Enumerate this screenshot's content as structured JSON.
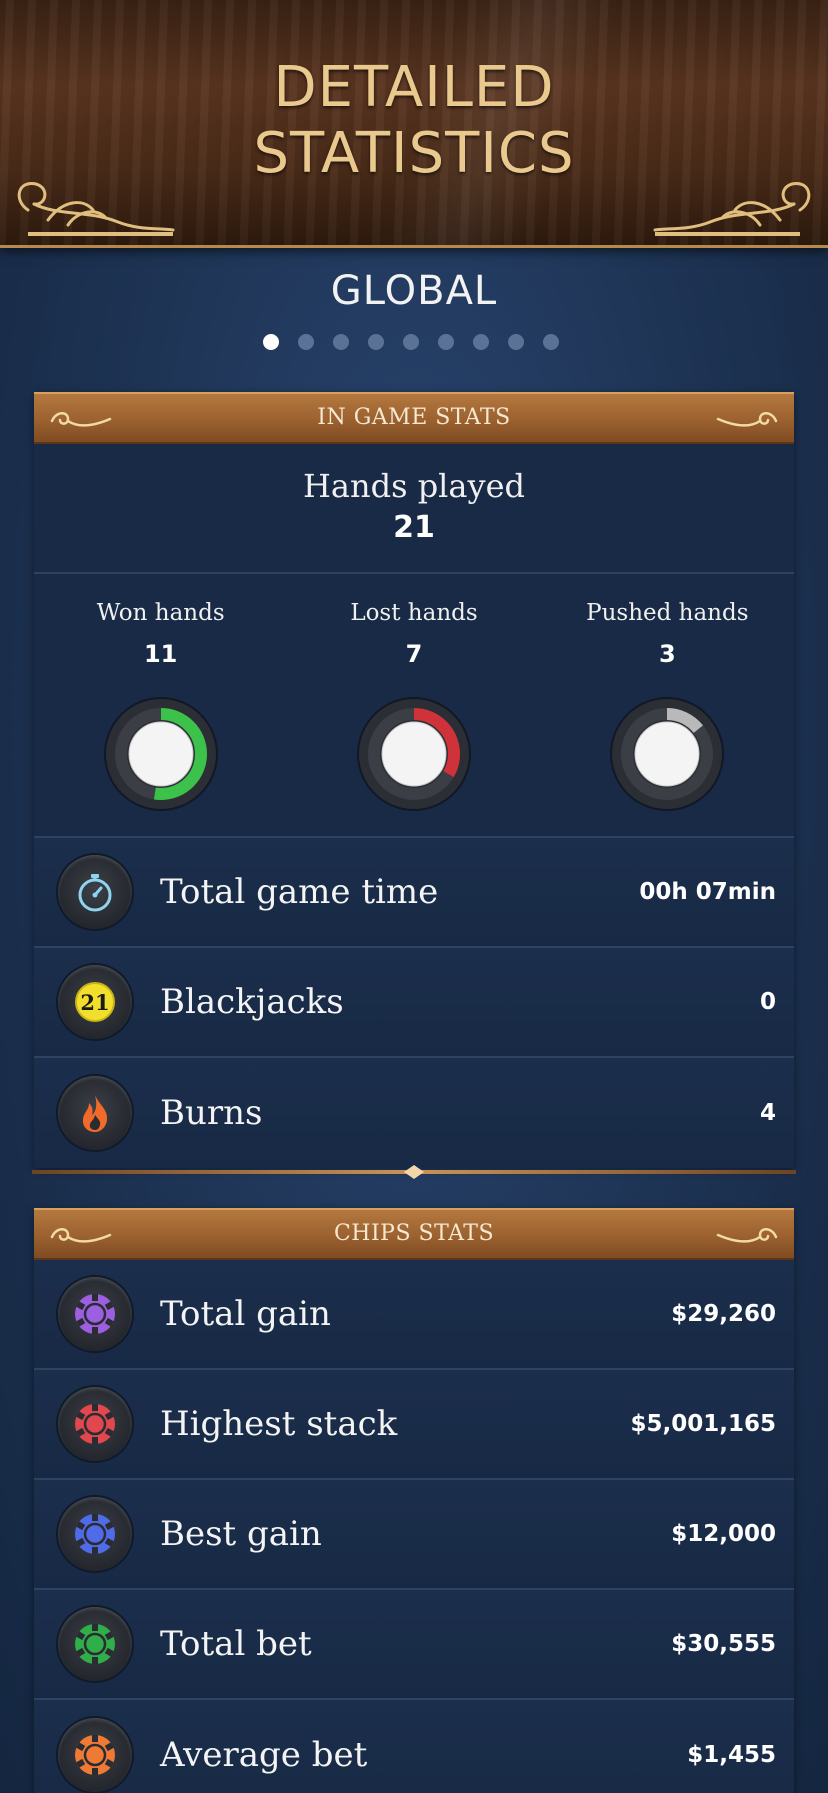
{
  "header": {
    "title_line1": "DETAILED",
    "title_line2": "STATISTICS"
  },
  "tab_label": "GLOBAL",
  "pager": {
    "total": 9,
    "active": 1
  },
  "in_game": {
    "title": "IN GAME STATS",
    "hands_played_label": "Hands played",
    "hands_played_value": "21",
    "breakdown": [
      {
        "label": "Won hands",
        "value": "11",
        "fraction": 0.5238,
        "color": "#3cc24a"
      },
      {
        "label": "Lost hands",
        "value": "7",
        "fraction": 0.3333,
        "color": "#d0323a"
      },
      {
        "label": "Pushed hands",
        "value": "3",
        "fraction": 0.1429,
        "color": "#b9b9b9"
      }
    ],
    "rows": [
      {
        "icon": "stopwatch-icon",
        "label": "Total game time",
        "value": "00h 07min"
      },
      {
        "icon": "blackjack-21-icon",
        "label": "Blackjacks",
        "value": "0"
      },
      {
        "icon": "flame-icon",
        "label": "Burns",
        "value": "4"
      }
    ]
  },
  "chips": {
    "title": "CHIPS STATS",
    "rows": [
      {
        "icon": "purple-chip-icon",
        "chip_color": "#9b5fe0",
        "label": "Total gain",
        "value": "$29,260"
      },
      {
        "icon": "red-chip-icon",
        "chip_color": "#e0474f",
        "label": "Highest stack",
        "value": "$5,001,165"
      },
      {
        "icon": "blue-chip-icon",
        "chip_color": "#4f6be8",
        "label": "Best gain",
        "value": "$12,000"
      },
      {
        "icon": "green-chip-icon",
        "chip_color": "#2fae4a",
        "label": "Total bet",
        "value": "$30,555"
      },
      {
        "icon": "orange-chip-icon",
        "chip_color": "#ef7a35",
        "label": "Average bet",
        "value": "$1,455"
      }
    ]
  },
  "colors": {
    "gold_title": "#e9c98e",
    "wood_header": "#9b612f",
    "panel_bg": "#182a46",
    "page_bg": "#1f3556"
  }
}
